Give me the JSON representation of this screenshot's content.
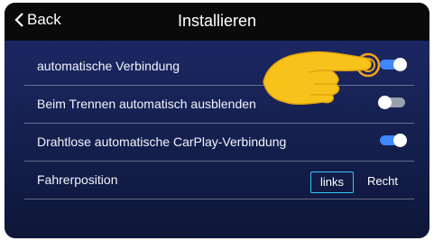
{
  "header": {
    "back_label": "Back",
    "title": "Installieren"
  },
  "settings": [
    {
      "label": "automatische Verbindung",
      "toggle": "on"
    },
    {
      "label": "Beim Trennen automatisch ausblenden",
      "toggle": "off"
    },
    {
      "label": "Drahtlose automatische CarPlay-Verbindung",
      "toggle": "on"
    }
  ],
  "driver_position": {
    "label": "Fahrerposition",
    "options": [
      "links",
      "Recht"
    ],
    "selected": "links"
  },
  "colors": {
    "accent": "#3f86ff",
    "selected_border": "#34c6ff",
    "header_bg": "#0a0a0a"
  },
  "icons": [
    "chevron-left-icon",
    "pointing-finger-icon"
  ]
}
